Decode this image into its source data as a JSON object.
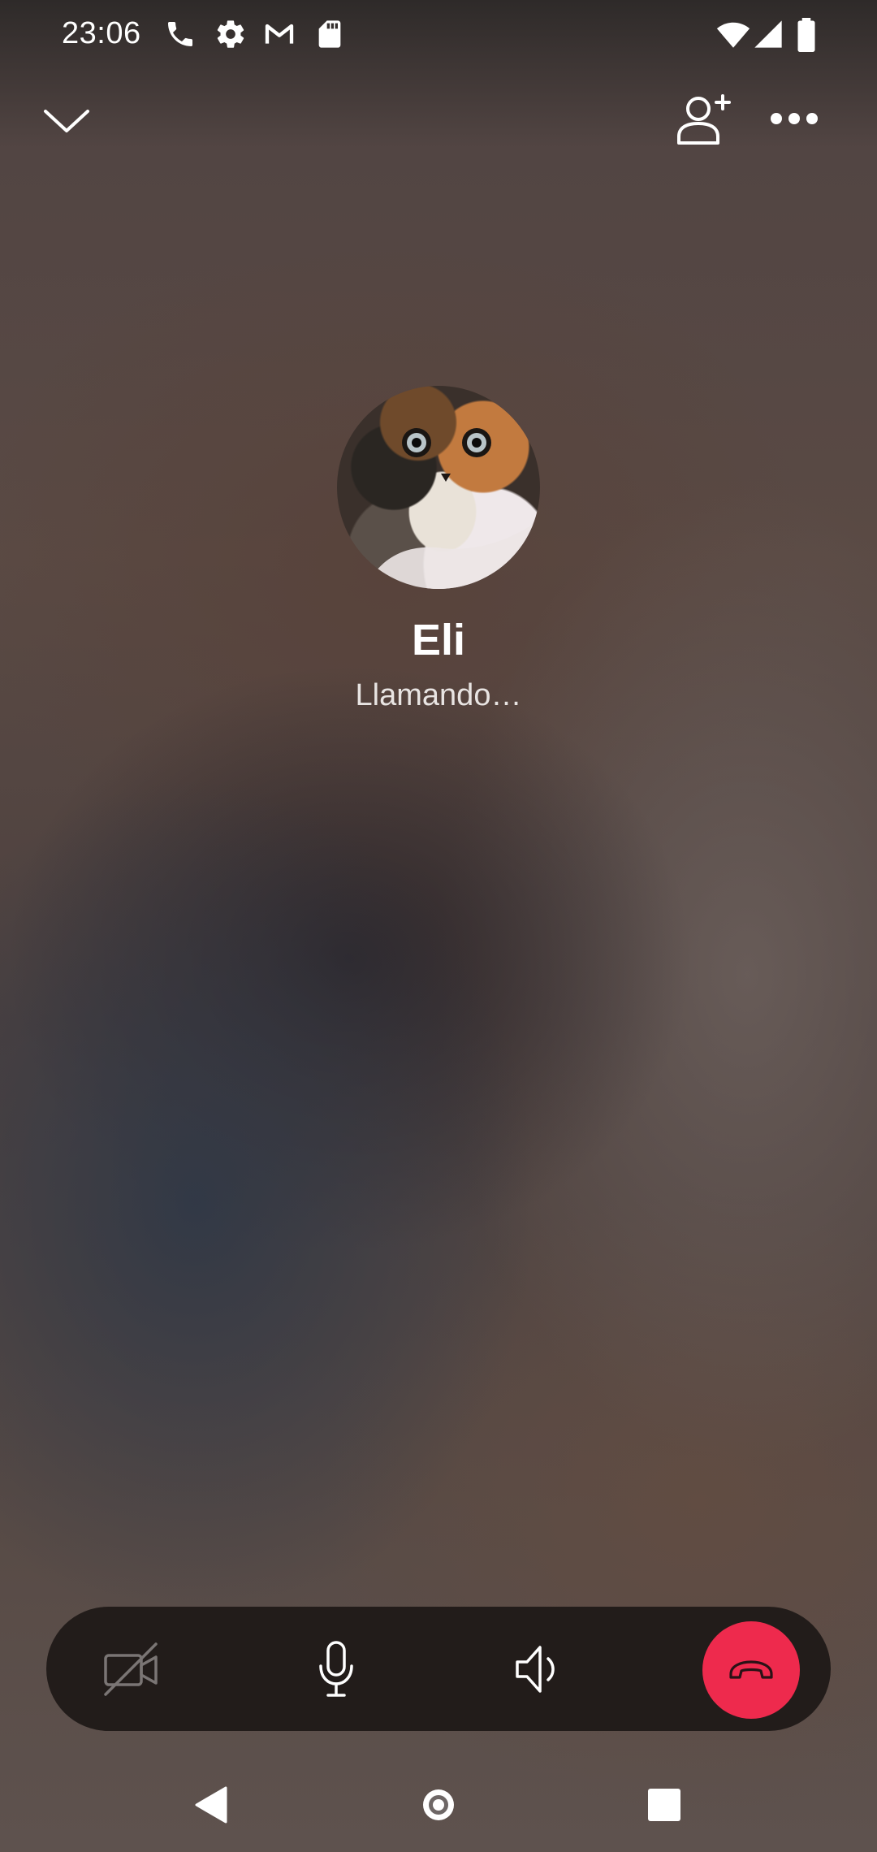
{
  "status_bar": {
    "time": "23:06",
    "left_icons": [
      "phone-icon",
      "settings-gear-icon",
      "gmail-icon",
      "sd-card-icon"
    ],
    "right_icons": [
      "wifi-icon",
      "cellular-signal-icon",
      "battery-icon"
    ]
  },
  "top_bar": {
    "minimize_icon": "chevron-down-icon",
    "add_participant_icon": "add-person-icon",
    "more_icon": "more-horizontal-icon"
  },
  "call": {
    "contact_name": "Eli",
    "status": "Llamando…",
    "avatar": "cat-avatar"
  },
  "controls": {
    "video_icon": "video-off-icon",
    "mic_icon": "microphone-icon",
    "speaker_icon": "speaker-icon",
    "hangup_icon": "hang-up-icon",
    "hangup_color": "#ee2a4d",
    "bar_color": "#221c1a"
  },
  "nav_bar": {
    "back_icon": "back-triangle-icon",
    "home_icon": "home-icon",
    "recents_icon": "recents-square-icon"
  }
}
